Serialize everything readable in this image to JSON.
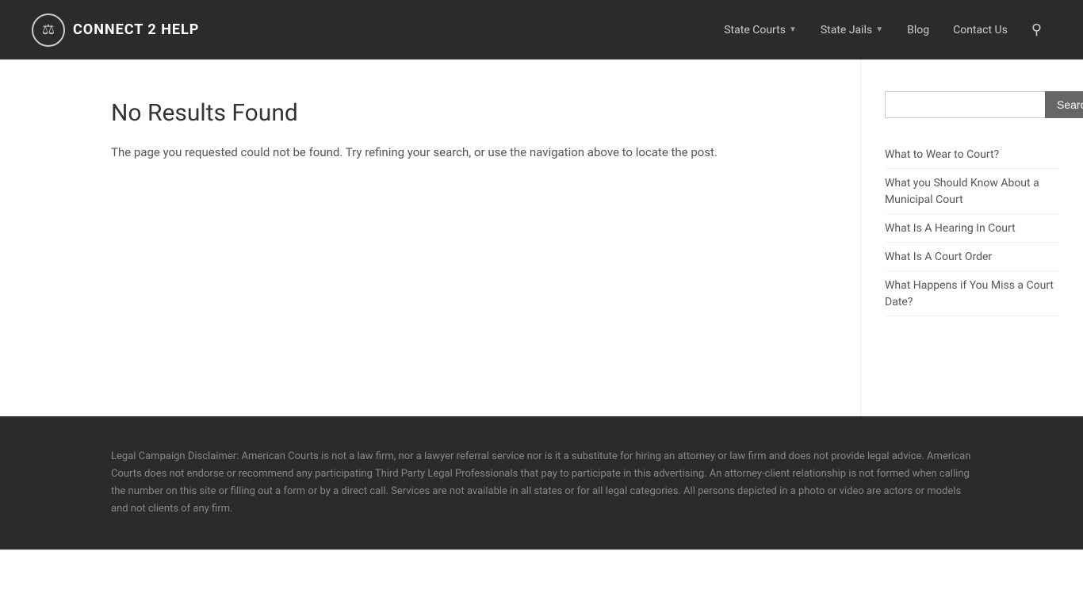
{
  "header": {
    "logo_text": "CONNECT 2 HELP",
    "logo_icon": "⚖",
    "nav_items": [
      {
        "label": "State Courts",
        "has_chevron": true
      },
      {
        "label": "State Jails",
        "has_chevron": true
      },
      {
        "label": "Blog",
        "has_chevron": false
      },
      {
        "label": "Contact Us",
        "has_chevron": false
      }
    ],
    "search_aria": "search"
  },
  "content": {
    "title": "No Results Found",
    "description": "The page you requested could not be found. Try refining your search, or use the navigation above to locate the post."
  },
  "sidebar": {
    "search_placeholder": "",
    "search_button_label": "Search",
    "links": [
      {
        "text": "What to Wear to Court?"
      },
      {
        "text": "What you Should Know About a Municipal Court"
      },
      {
        "text": "What Is A Hearing In Court"
      },
      {
        "text": "What Is A Court Order"
      },
      {
        "text": "What Happens if You Miss a Court Date?"
      }
    ]
  },
  "footer": {
    "disclaimer": "Legal Campaign Disclaimer: American Courts is not a law firm, nor a lawyer referral service nor is it a substitute for hiring an attorney or law firm and does not provide legal advice. American Courts does not endorse or recommend any participating Third Party Legal Professionals that pay to participate in this advertising. An attorney-client relationship is not formed when calling the number on this site or filling out a form or by a direct call. Services are not available in all states or for all legal categories. All persons depicted in a photo or video are actors or models and not clients of any firm."
  }
}
